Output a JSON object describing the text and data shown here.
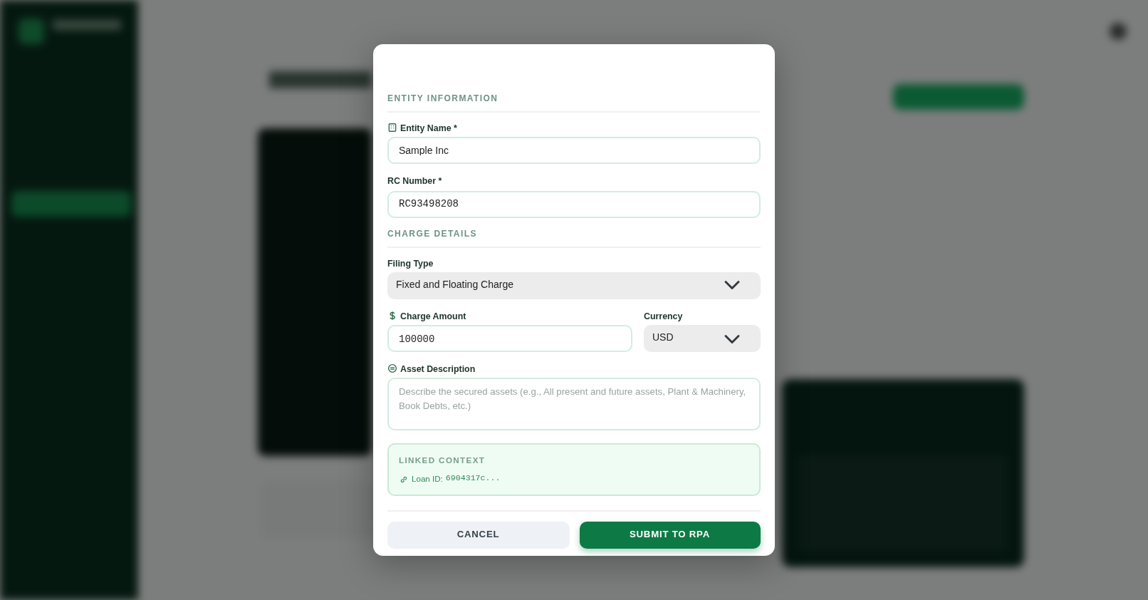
{
  "dialog": {
    "sections": [
      {
        "heading": "ENTITY INFORMATION",
        "fields": [
          {
            "kind": "input",
            "label": "Entity Name *",
            "value": "Sample Inc"
          },
          {
            "kind": "input",
            "label": "RC Number *",
            "value": "RC93498208"
          }
        ]
      },
      {
        "heading": "CHARGE DETAILS",
        "fields": [
          {
            "kind": "select",
            "label": "Filing Type",
            "value": "Fixed and Floating Charge"
          },
          {
            "kind": "pair",
            "items": [
              {
                "kind": "input",
                "label": "Charge Amount",
                "value": "100000"
              },
              {
                "kind": "select",
                "label": "Currency",
                "value": "USD"
              }
            ]
          },
          {
            "kind": "textarea",
            "label": "Asset Description",
            "placeholder": "Describe the secured assets (e.g., All present and future assets, Plant & Machinery, Book Debts, etc.)"
          }
        ]
      }
    ],
    "linked_context": {
      "heading": "LINKED CONTEXT",
      "label": "Loan ID:",
      "value": "6904317c..."
    },
    "buttons": [
      {
        "label": "CANCEL",
        "kind": "secondary"
      },
      {
        "label": "SUBMIT TO RPA",
        "kind": "primary"
      }
    ]
  }
}
